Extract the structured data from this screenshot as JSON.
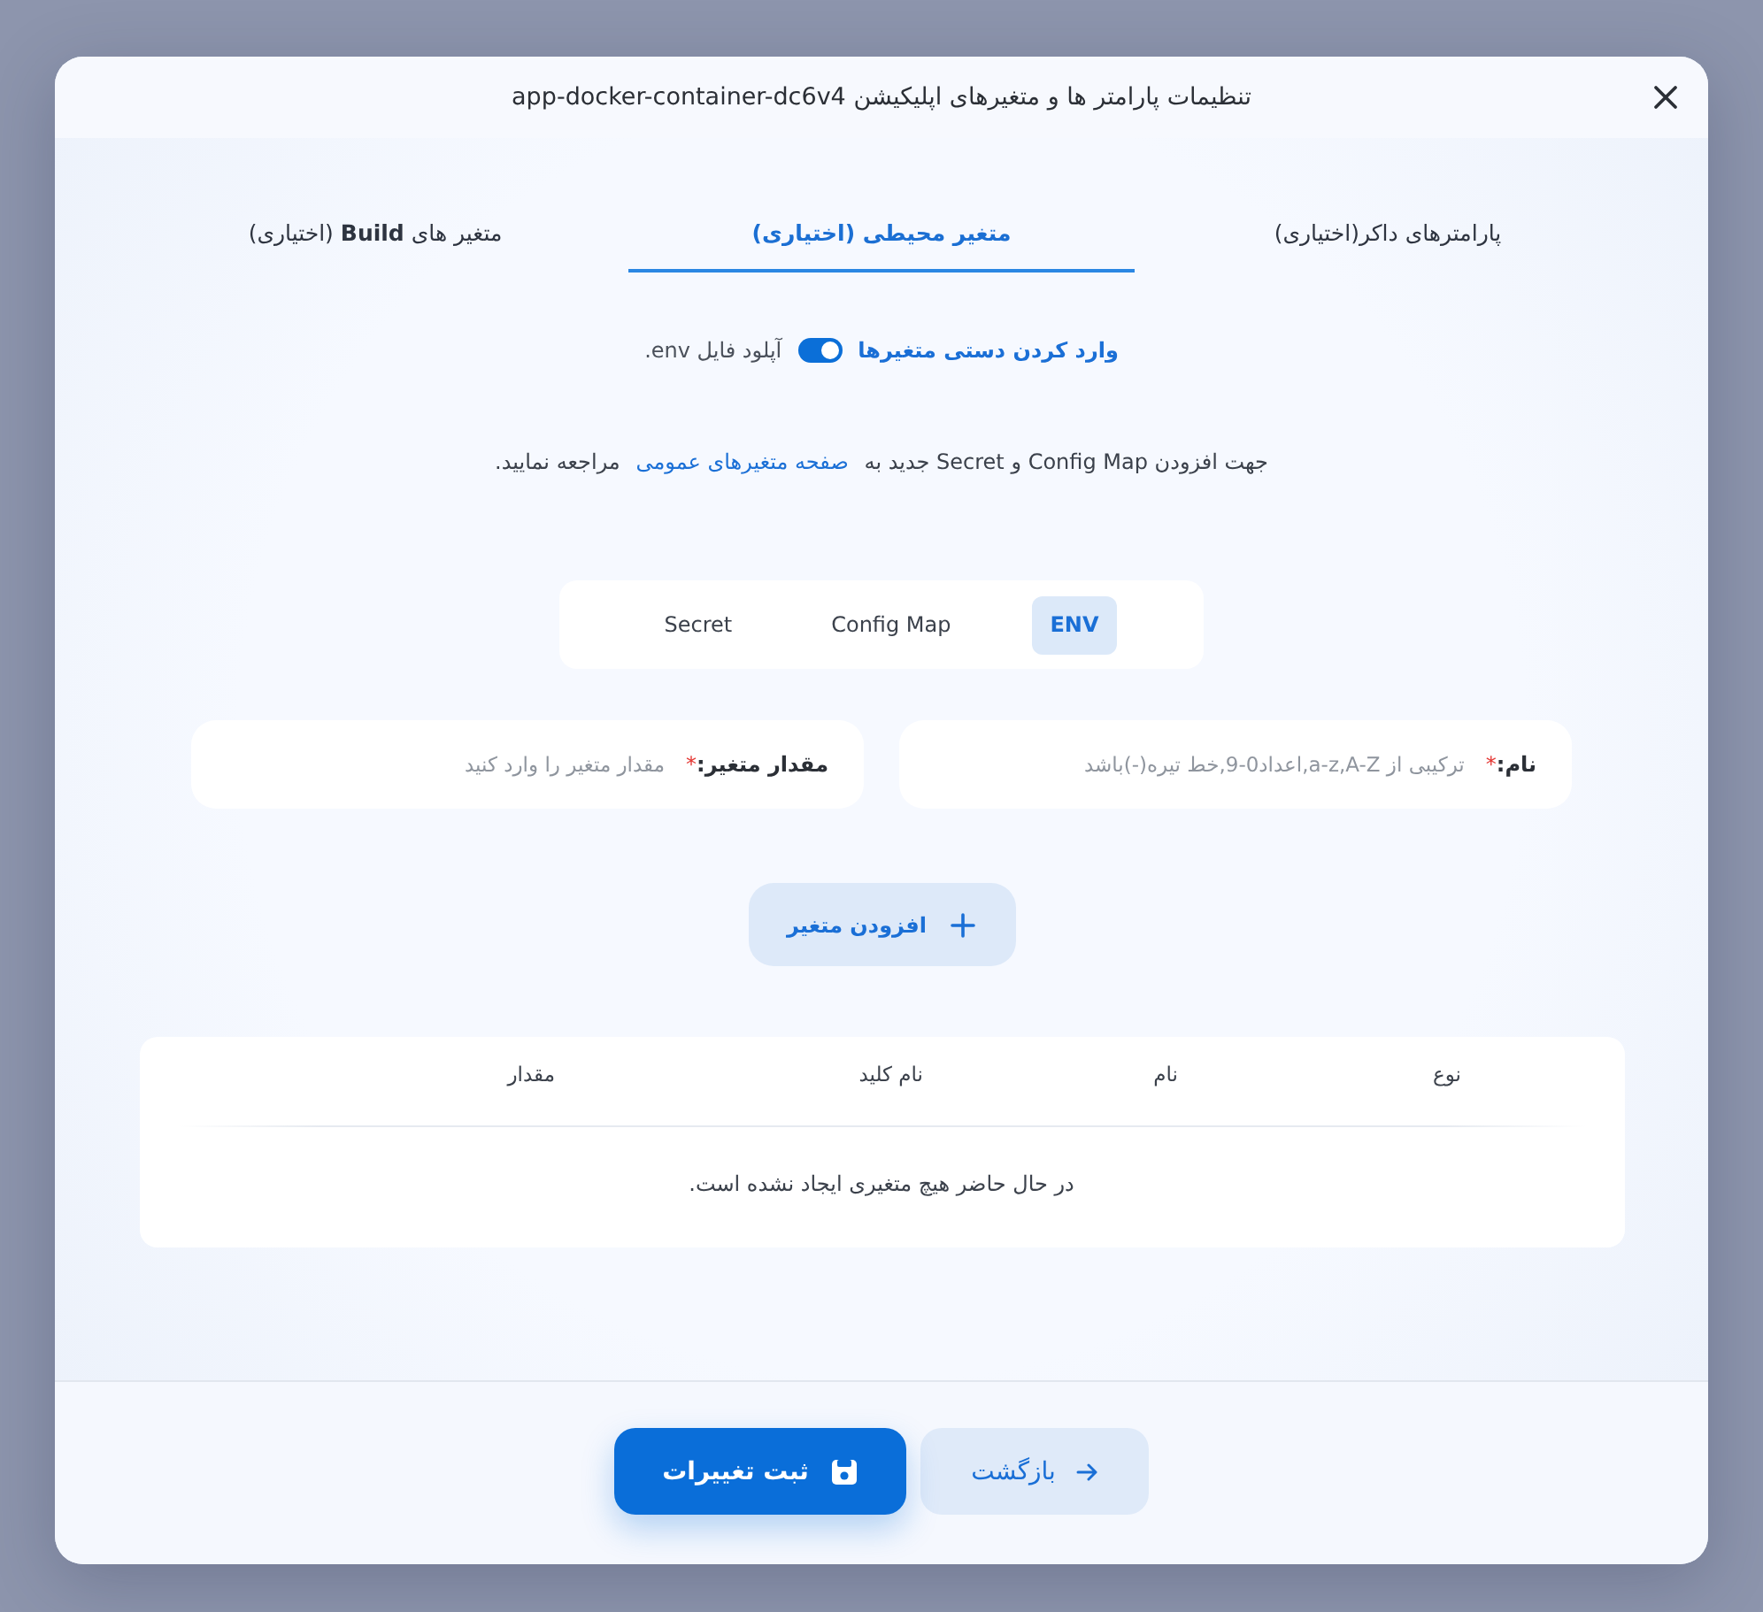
{
  "dialog": {
    "title": "تنظیمات پارامتر ها و متغیرهای اپلیکیشن app-docker-container-dc6v4"
  },
  "tabs": [
    {
      "label": "پارامترهای داکر(اختیاری)",
      "selected": false
    },
    {
      "label": "متغیر محیطی (اختیاری)",
      "selected": true
    },
    {
      "label": "متغیر های **Build** (اختیاری)",
      "selected": false
    }
  ],
  "manual_entry_switch": {
    "on": true,
    "on_label": "وارد کردن دستی متغیرها",
    "off_label": "آپلود فایل env."
  },
  "notice": {
    "before": "جهت افزودن Config Map و Secret جدید به",
    "link": "صفحه متغیرهای عمومی",
    "after": "مراجعه نمایید."
  },
  "variable_types": [
    {
      "label": "ENV",
      "selected": true
    },
    {
      "label": "Config Map",
      "selected": false
    },
    {
      "label": "Secret",
      "selected": false
    }
  ],
  "fields": [
    {
      "label": "نام:",
      "required_mark": "*",
      "placeholder": "ترکیبی از a-z,A-Z,اعداد0-9,خط تیره(-)باشد"
    },
    {
      "label": "مقدار متغیر:",
      "required_mark": "*",
      "placeholder": "مقدار متغیر را وارد کنید"
    }
  ],
  "add_button": {
    "label": "افزودن متغیر"
  },
  "table": {
    "columns": [
      "نوع",
      "نام",
      "نام کلید",
      "مقدار"
    ],
    "empty_message": "در حال حاضر هیچ متغیری ایجاد نشده است."
  },
  "footer": {
    "buttons": [
      {
        "label": "بازگشت",
        "kind": "secondary"
      },
      {
        "label": "ثبت تغییرات",
        "kind": "primary"
      }
    ]
  }
}
